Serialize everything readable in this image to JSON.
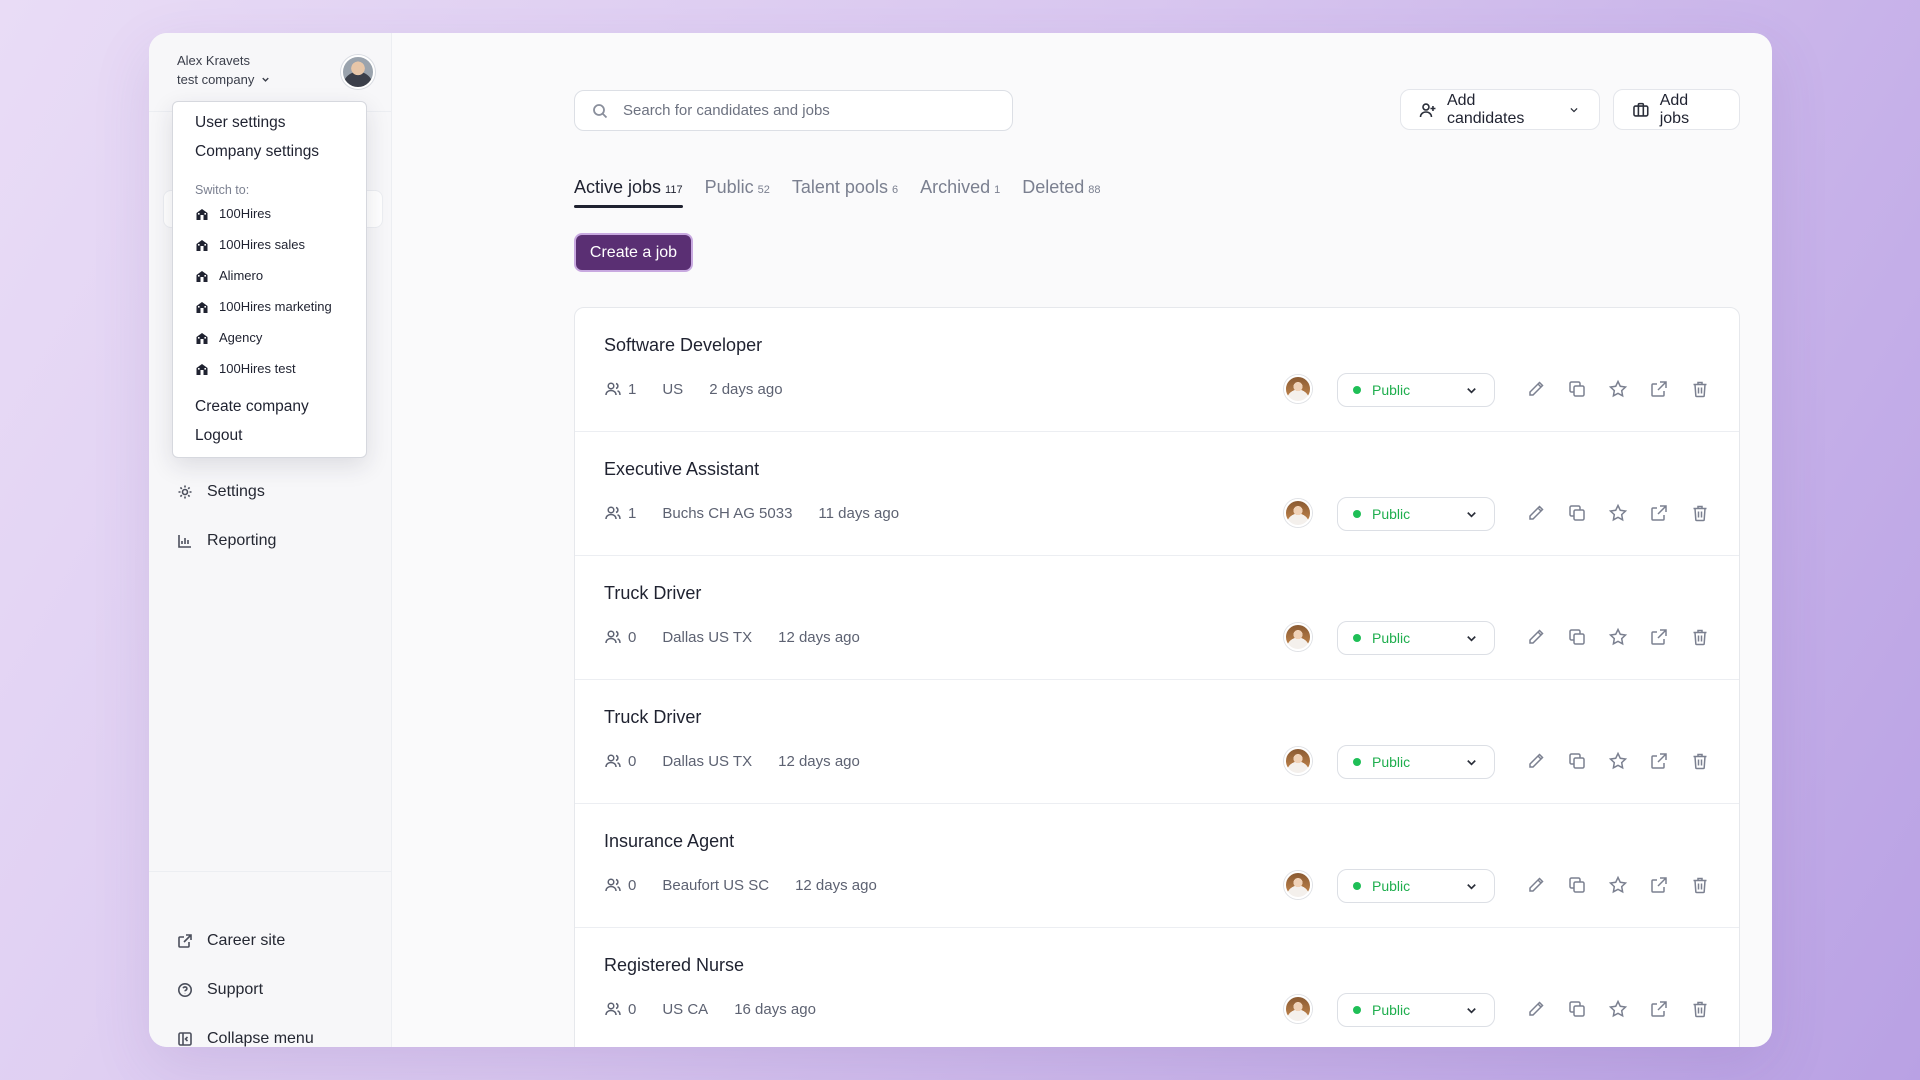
{
  "user": {
    "name": "Alex Kravets",
    "company": "test company"
  },
  "menu": {
    "user_settings": "User settings",
    "company_settings": "Company settings",
    "switch_label": "Switch to:",
    "companies": [
      "100Hires",
      "100Hires sales",
      "Alimero",
      "100Hires marketing",
      "Agency",
      "100Hires test"
    ],
    "create_company": "Create company",
    "logout": "Logout"
  },
  "sidebar": {
    "settings": "Settings",
    "reporting": "Reporting",
    "career_site": "Career site",
    "support": "Support",
    "collapse_menu": "Collapse menu"
  },
  "search": {
    "placeholder": "Search for candidates and jobs"
  },
  "header": {
    "add_candidates": "Add candidates",
    "add_jobs": "Add jobs"
  },
  "tabs": [
    {
      "label": "Active jobs",
      "count": "117"
    },
    {
      "label": "Public",
      "count": "52"
    },
    {
      "label": "Talent pools",
      "count": "6"
    },
    {
      "label": "Archived",
      "count": "1"
    },
    {
      "label": "Deleted",
      "count": "88"
    }
  ],
  "create_job": "Create a job",
  "jobs": [
    {
      "title": "Software Developer",
      "candidates": "1",
      "location": "US",
      "age": "2 days ago",
      "status": "Public"
    },
    {
      "title": "Executive Assistant",
      "candidates": "1",
      "location": "Buchs CH AG 5033",
      "age": "11 days ago",
      "status": "Public"
    },
    {
      "title": "Truck Driver",
      "candidates": "0",
      "location": "Dallas US TX",
      "age": "12 days ago",
      "status": "Public"
    },
    {
      "title": "Truck Driver",
      "candidates": "0",
      "location": "Dallas US TX",
      "age": "12 days ago",
      "status": "Public"
    },
    {
      "title": "Insurance Agent",
      "candidates": "0",
      "location": "Beaufort US SC",
      "age": "12 days ago",
      "status": "Public"
    },
    {
      "title": "Registered Nurse",
      "candidates": "0",
      "location": "US CA",
      "age": "16 days ago",
      "status": "Public"
    }
  ],
  "colors": {
    "accent": "#5a2f73",
    "status_public": "#1fbf57"
  }
}
